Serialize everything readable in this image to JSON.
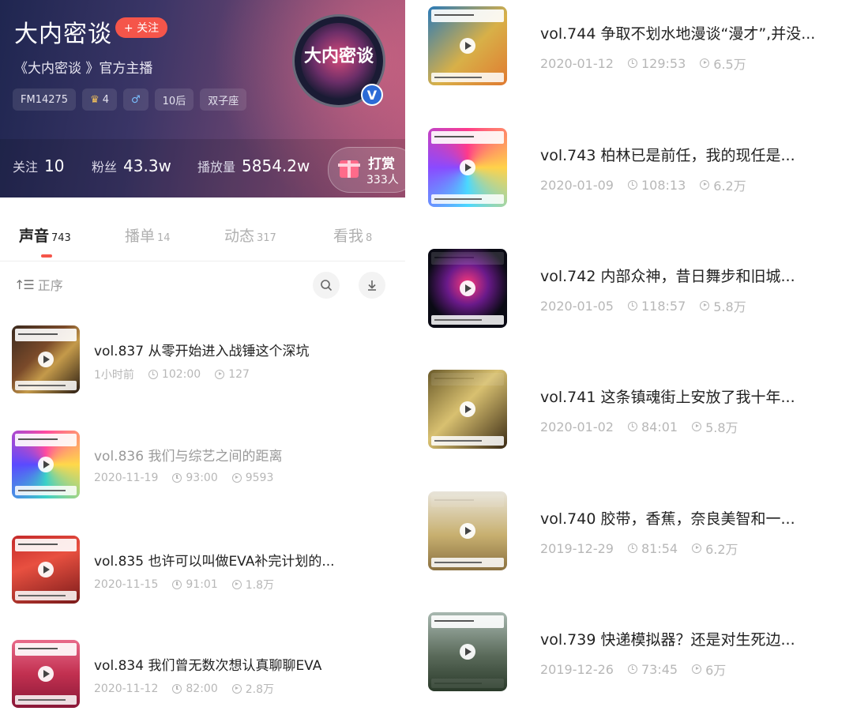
{
  "header": {
    "title": "大内密谈",
    "follow_label": "+ 关注",
    "subtitle": "《大内密谈 》官方主播",
    "tags": [
      "FM14275",
      "4",
      "10后",
      "双子座"
    ],
    "avatar_text": "大内密谈",
    "verified_badge": "V",
    "stats": {
      "following_label": "关注",
      "following_value": "10",
      "fans_label": "粉丝",
      "fans_value": "43.3w",
      "plays_label": "播放量",
      "plays_value": "5854.2w"
    },
    "reward": {
      "label": "打赏",
      "count": "333人"
    }
  },
  "tabs": [
    {
      "label": "声音",
      "count": "743"
    },
    {
      "label": "播单",
      "count": "14"
    },
    {
      "label": "动态",
      "count": "317"
    },
    {
      "label": "看我",
      "count": "8"
    }
  ],
  "toolbar": {
    "sort_label": "正序"
  },
  "left_list": [
    {
      "title": "vol.837 从零开始进入战锤这个深坑",
      "date": "1小时前",
      "duration": "102:00",
      "plays": "127"
    },
    {
      "title": "vol.836 我们与综艺之间的距离",
      "date": "2020-11-19",
      "duration": "93:00",
      "plays": "9593"
    },
    {
      "title": "vol.835 也许可以叫做EVA补完计划的...",
      "date": "2020-11-15",
      "duration": "91:01",
      "plays": "1.8万"
    },
    {
      "title": "vol.834 我们曾无数次想认真聊聊EVA",
      "date": "2020-11-12",
      "duration": "82:00",
      "plays": "2.8万"
    }
  ],
  "right_list": [
    {
      "title": "vol.744 争取不划水地漫谈“漫才”,并没...",
      "date": "2020-01-12",
      "duration": "129:53",
      "plays": "6.5万"
    },
    {
      "title": "vol.743 柏林已是前任，我的现任是...",
      "date": "2020-01-09",
      "duration": "108:13",
      "plays": "6.2万"
    },
    {
      "title": "vol.742 内部众神，昔日舞步和旧城...",
      "date": "2020-01-05",
      "duration": "118:57",
      "plays": "5.8万"
    },
    {
      "title": "vol.741 这条镇魂街上安放了我十年...",
      "date": "2020-01-02",
      "duration": "84:01",
      "plays": "5.8万"
    },
    {
      "title": "vol.740 胶带，香蕉，奈良美智和一...",
      "date": "2019-12-29",
      "duration": "81:54",
      "plays": "6.2万"
    },
    {
      "title": "vol.739 快递模拟器？还是对生死边...",
      "date": "2019-12-26",
      "duration": "73:45",
      "plays": "6万"
    }
  ],
  "colors": {
    "accent": "#f5554a",
    "verified": "#2c6bd6",
    "meta_text": "#b7b7b7"
  },
  "icons": [
    "plus-icon",
    "crown-icon",
    "male-icon",
    "gift-icon",
    "sort-icon",
    "search-icon",
    "download-icon",
    "clock-icon",
    "play-count-icon",
    "play-icon",
    "verified-icon"
  ]
}
